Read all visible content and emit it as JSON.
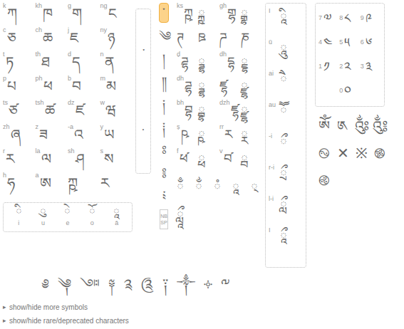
{
  "consonants": [
    [
      {
        "label": "k",
        "char": "ཀ"
      },
      {
        "label": "kh",
        "char": "ཁ"
      },
      {
        "label": "g",
        "char": "ག"
      },
      {
        "label": "ng",
        "char": "ང"
      }
    ],
    [
      {
        "label": "c",
        "char": "ཅ"
      },
      {
        "label": "ch",
        "char": "ཆ"
      },
      {
        "label": "j",
        "char": "ཇ"
      },
      {
        "label": "ny",
        "char": "ཉ"
      }
    ],
    [
      {
        "label": "t",
        "char": "ཏ"
      },
      {
        "label": "th",
        "char": "ཐ"
      },
      {
        "label": "d",
        "char": "ད"
      },
      {
        "label": "n",
        "char": "ན"
      }
    ],
    [
      {
        "label": "p",
        "char": "པ"
      },
      {
        "label": "ph",
        "char": "ཕ"
      },
      {
        "label": "b",
        "char": "བ"
      },
      {
        "label": "m",
        "char": "མ"
      }
    ],
    [
      {
        "label": "ts",
        "char": "ཙ"
      },
      {
        "label": "tsh",
        "char": "ཚ"
      },
      {
        "label": "dz",
        "char": "ཛ"
      },
      {
        "label": "w",
        "char": "ཝ"
      }
    ],
    [
      {
        "label": "zh",
        "char": "ཞ"
      },
      {
        "label": "z",
        "char": "ཟ"
      },
      {
        "label": "-a",
        "char": "འ"
      },
      {
        "label": "y",
        "char": "ཡ"
      }
    ],
    [
      {
        "label": "r",
        "char": "ར"
      },
      {
        "label": "la",
        "char": "ལ"
      },
      {
        "label": "sh",
        "char": "ཤ"
      },
      {
        "label": "s",
        "char": "ས"
      }
    ],
    [
      {
        "label": "h",
        "char": "ཧ"
      },
      {
        "label": "a",
        "char": "ཨ"
      },
      {
        "label": "",
        "char": "ཀྵ"
      },
      {
        "label": "",
        "char": "ཪ"
      }
    ]
  ],
  "vowels": [
    {
      "label": "i",
      "char": "ི"
    },
    {
      "label": "u",
      "char": "ུ"
    },
    {
      "label": "e",
      "char": "ེ"
    },
    {
      "label": "o",
      "char": "ོ"
    },
    {
      "label": "ā",
      "char": "ཱ"
    }
  ],
  "punctuation": [
    {
      "char": "་",
      "selected": false
    },
    {
      "char": "·",
      "selected": false
    }
  ],
  "marks": [
    {
      "char": "་",
      "selected": true
    },
    {
      "char": "༄",
      "selected": false
    },
    {
      "char": "།",
      "selected": false
    },
    {
      "char": "༎",
      "selected": false
    },
    {
      "char": "༏",
      "selected": false
    },
    {
      "char": "༐",
      "selected": false
    },
    {
      "char": "ཿ",
      "selected": false
    },
    {
      "char": "༔",
      "selected": false
    },
    {
      "char": "༴",
      "selected": false
    }
  ],
  "nbsp": "NBSP",
  "extended": [
    {
      "label": "ks",
      "char": "ཀྵ"
    },
    {
      "label": "",
      "char": "ྐྵ"
    },
    {
      "label": "gh",
      "char": "གྷ"
    },
    {
      "label": "",
      "char": "ྒྷ"
    },
    {
      "label": "",
      "char": "ཊ"
    },
    {
      "label": "",
      "char": "ཋ"
    },
    {
      "label": "",
      "char": "ཌ"
    },
    {
      "label": "",
      "char": "ཎ"
    },
    {
      "label": "ḍ",
      "char": "ཌྷ"
    },
    {
      "label": "",
      "char": "ྜྷ"
    },
    {
      "label": "dh",
      "char": "དྷ"
    },
    {
      "label": "",
      "char": "ྡྷ"
    },
    {
      "label": "dh",
      "char": "ཌྷ"
    },
    {
      "label": "",
      "char": "ྜྷ"
    },
    {
      "label": "",
      "char": "ཛྷ"
    },
    {
      "label": "",
      "char": "ྫྷ"
    },
    {
      "label": "bh",
      "char": "བྷ"
    },
    {
      "label": "",
      "char": "ྦྷ"
    },
    {
      "label": "dzh",
      "char": "ཛྷ"
    },
    {
      "label": "",
      "char": "ྫྷ"
    },
    {
      "label": "ṣ",
      "char": "ཥ"
    },
    {
      "label": "",
      "char": "ྵ"
    },
    {
      "label": "rr",
      "char": "ཪ"
    },
    {
      "label": "",
      "char": "ྼ"
    },
    {
      "label": "f",
      "char": "ཕ༹"
    },
    {
      "label": "",
      "char": "ྥ"
    },
    {
      "label": "v",
      "char": "བ༹"
    },
    {
      "label": "",
      "char": "ྦ"
    }
  ],
  "signs": [
    {
      "char": "ྃ"
    },
    {
      "char": "ྂ"
    },
    {
      "char": "ཾ"
    },
    {
      "char": "ཱ"
    },
    {
      "char": "྄"
    },
    {
      "char": "ཹ"
    }
  ],
  "vowel_signs": [
    {
      "label": "I",
      "char": "ཱི"
    },
    {
      "label": "ū",
      "char": "ཱུ"
    },
    {
      "label": "ai",
      "char": "ཻ"
    },
    {
      "label": "au",
      "char": "ཽ"
    },
    {
      "label": "-i",
      "char": "ྀ"
    },
    {
      "label": "r-i",
      "char": "ྲྀ"
    },
    {
      "label": "l-i",
      "char": "ླྀ"
    },
    {
      "label": "I",
      "char": "ཱྀ"
    }
  ],
  "digits": [
    {
      "label": "7",
      "char": "༧"
    },
    {
      "label": "8",
      "char": "༨"
    },
    {
      "label": "9",
      "char": "༩"
    },
    {
      "label": "4",
      "char": "༤"
    },
    {
      "label": "5",
      "char": "༥"
    },
    {
      "label": "6",
      "char": "༦"
    },
    {
      "label": "1",
      "char": "༡"
    },
    {
      "label": "2",
      "char": "༢"
    },
    {
      "label": "3",
      "char": "༣"
    },
    {
      "label": "",
      "char": ""
    },
    {
      "label": "0",
      "char": "༠"
    },
    {
      "label": "",
      "char": ""
    }
  ],
  "symbols": [
    "ༀ",
    "༁",
    "༂",
    "༃",
    "࿊",
    "✕",
    "※",
    "࿌",
    "࿋"
  ],
  "ornaments": [
    "༅",
    "༆",
    "༇",
    "༈",
    "༉",
    "༊",
    "༑",
    "༒",
    "༓",
    "༸"
  ],
  "links": [
    {
      "icon": "▸",
      "label": "show/hide more symbols"
    },
    {
      "icon": "▸",
      "label": "show/hide rare/deprecated characters"
    }
  ]
}
